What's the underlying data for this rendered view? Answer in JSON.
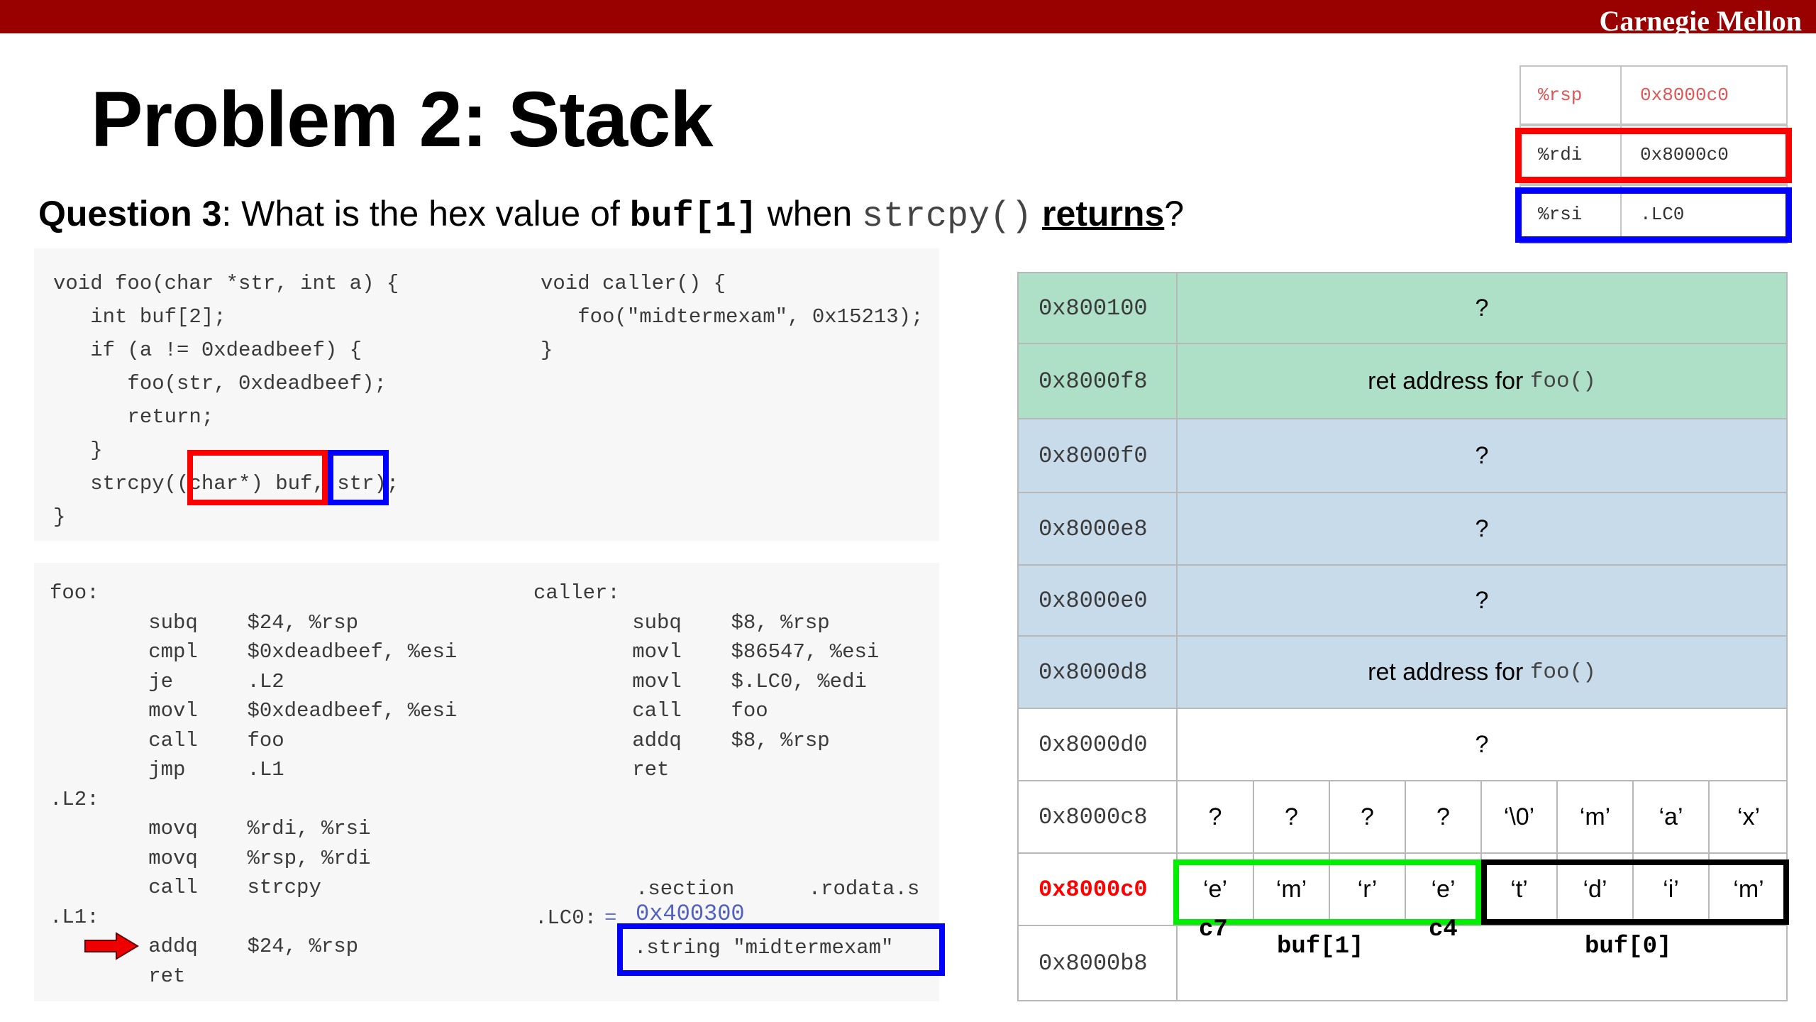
{
  "header": {
    "brand": "Carnegie Mellon",
    "title": "Problem 2: Stack"
  },
  "question": {
    "label": "Question 3",
    "text_before": ": What is the hex value of ",
    "buf": "buf[1]",
    "text_mid": " when ",
    "func": "strcpy()",
    "text_space": " ",
    "returns": "returns",
    "text_end": "?"
  },
  "registers": [
    {
      "name": "%rsp",
      "value": "0x8000c0",
      "color": "#e05555",
      "highlight": ""
    },
    {
      "name": "%rdi",
      "value": "0x8000c0",
      "color": "#333333",
      "highlight": "#ff0000"
    },
    {
      "name": "%rsi",
      "value": ".LC0",
      "color": "#333333",
      "highlight": "#0000ff"
    }
  ],
  "c_code": {
    "foo": "void foo(char *str, int a) {\n   int buf[2];\n   if (a != 0xdeadbeef) {\n      foo(str, 0xdeadbeef);\n      return;\n   }\n   strcpy((char*) buf, str);\n}",
    "caller": "void caller() {\n   foo(\"midtermexam\", 0x15213);\n}"
  },
  "asm_code": {
    "foo": "foo:\n        subq    $24, %rsp\n        cmpl    $0xdeadbeef, %esi\n        je      .L2\n        movl    $0xdeadbeef, %esi\n        call    foo\n        jmp     .L1\n.L2:\n        movq    %rdi, %rsi\n        movq    %rsp, %rdi\n        call    strcpy\n.L1:\n        addq    $24, %rsp\n        ret",
    "caller": "caller:\n        subq    $8, %rsp\n        movl    $86547, %esi\n        movl    $.LC0, %edi\n        call    foo\n        addq    $8, %rsp\n        ret",
    "section": ".section      .rodata.s",
    "lc0_label": ".LC0:",
    "lc0_eq": "=",
    "lc0_addr": "0x400300",
    "string_line": ".string \"midtermexam\""
  },
  "colors": {
    "red": "#ff0000",
    "blue": "#0000ff",
    "green": "#00ee00",
    "black": "#000000",
    "cmu_red": "#990000",
    "stack_green": "#aee0c8",
    "stack_blue": "#c8dbea"
  },
  "stack": [
    {
      "addr": "0x800100",
      "content": "?",
      "bg": "#aee0c8"
    },
    {
      "addr": "0x8000f8",
      "content": "ret address for ",
      "mono": "foo()",
      "bg": "#aee0c8"
    },
    {
      "addr": "0x8000f0",
      "content": "?",
      "bg": "#c8dbea"
    },
    {
      "addr": "0x8000e8",
      "content": "?",
      "bg": "#c8dbea"
    },
    {
      "addr": "0x8000e0",
      "content": "?",
      "bg": "#c8dbea"
    },
    {
      "addr": "0x8000d8",
      "content": "ret address for ",
      "mono": "foo()",
      "bg": "#c8dbea"
    },
    {
      "addr": "0x8000d0",
      "content": "?",
      "bg": "#ffffff"
    },
    {
      "addr": "0x8000c8",
      "bytes": [
        "?",
        "?",
        "?",
        "?",
        "‘\\0’",
        "‘m’",
        "‘a’",
        "‘x’"
      ],
      "bg": "#ffffff"
    },
    {
      "addr": "0x8000c0",
      "bytes": [
        "‘e’",
        "‘m’",
        "‘r’",
        "‘e’",
        "‘t’",
        "‘d’",
        "‘i’",
        "‘m’"
      ],
      "bg": "#ffffff",
      "addr_color": "#ff0000"
    },
    {
      "addr": "0x8000b8",
      "bg": "#ffffff"
    }
  ],
  "annotations": {
    "c7": "c7",
    "c4": "c4",
    "buf1": "buf[1]",
    "buf0": "buf[0]"
  }
}
